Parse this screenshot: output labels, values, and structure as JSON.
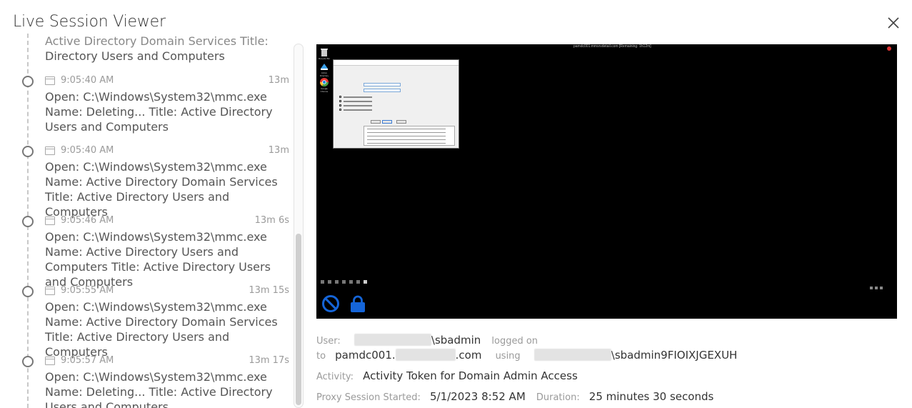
{
  "dialog": {
    "title": "Live Session Viewer"
  },
  "timeline": {
    "top_text_struck": "Active Directory Domain Services Title: Active",
    "top_text": "Directory Users and Computers",
    "entries": [
      {
        "time": "9:05:40 AM",
        "duration": "13m",
        "desc": "Open: C:\\Windows\\System32\\mmc.exe Name: Deleting... Title: Active Directory Users and Computers"
      },
      {
        "time": "9:05:40 AM",
        "duration": "13m",
        "desc": "Open: C:\\Windows\\System32\\mmc.exe Name: Active Directory Domain Services Title: Active Directory Users and Computers"
      },
      {
        "time": "9:05:46 AM",
        "duration": "13m 6s",
        "desc": "Open: C:\\Windows\\System32\\mmc.exe Name: Active Directory Users and Computers Title: Active Directory Users and Computers"
      },
      {
        "time": "9:05:55 AM",
        "duration": "13m 15s",
        "desc": "Open: C:\\Windows\\System32\\mmc.exe Name: Active Directory Domain Services Title: Active Directory Users and Computers"
      },
      {
        "time": "9:05:57 AM",
        "duration": "13m 17s",
        "desc": "Open: C:\\Windows\\System32\\mmc.exe Name: Deleting... Title: Active Directory Users and Computers"
      }
    ]
  },
  "video": {
    "top_bar_text": "pamdc001.mmsrvdetail.com [Remaining: 1h12m]",
    "desktop_icons": [
      "Recycle Bin",
      "Active Directory",
      "Google Chrome"
    ]
  },
  "session": {
    "user_label": "User:",
    "user_value": "\\sbadmin",
    "logged_on_label": "logged on",
    "to_label": "to",
    "host_prefix": "pamdc001.",
    "host_suffix": ".com",
    "using_label": "using",
    "account_value": "\\sbadmin9FIOIXJGEXUH",
    "activity_label": "Activity:",
    "activity_value": "Activity Token for Domain Admin Access",
    "started_label": "Proxy Session Started:",
    "started_value": "5/1/2023 8:52 AM",
    "duration_label": "Duration:",
    "duration_value": "25 minutes 30 seconds"
  },
  "colors": {
    "accent_blue": "#1565d8",
    "timeline_line": "#c8c8c8",
    "video_bg": "#000000"
  },
  "icons": {
    "close": "close-icon",
    "block": "block-icon",
    "lock": "lock-icon",
    "window": "window-icon"
  }
}
